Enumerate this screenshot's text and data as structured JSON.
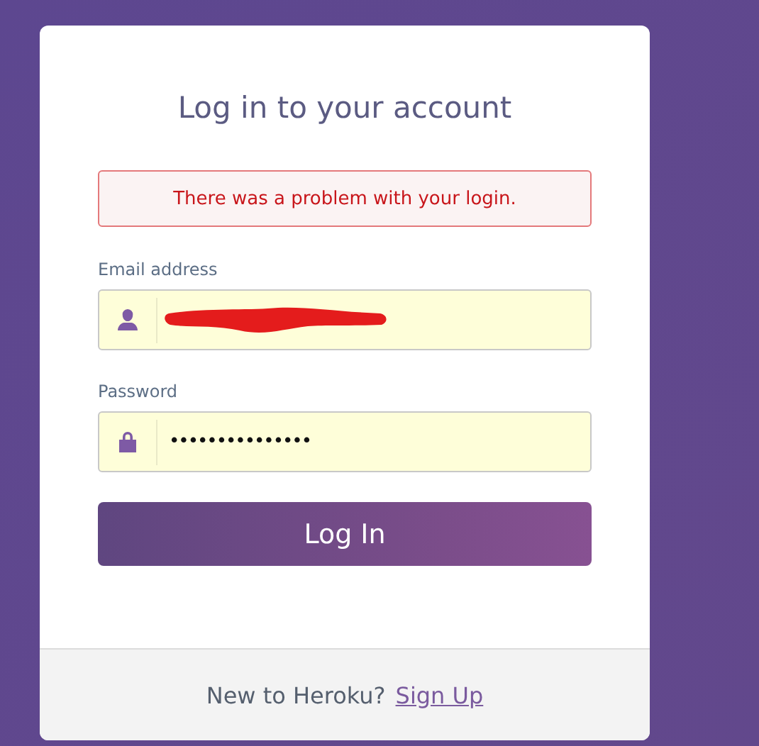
{
  "title": "Log in to your account",
  "error": "There was a problem with your login.",
  "fields": [
    {
      "kind": "email",
      "label": "Email address",
      "redacted": true
    },
    {
      "kind": "password",
      "label": "Password",
      "value": "•••••••••••••••"
    }
  ],
  "submit": "Log In",
  "footer": {
    "text": "New to Heroku?",
    "link": "Sign Up"
  }
}
